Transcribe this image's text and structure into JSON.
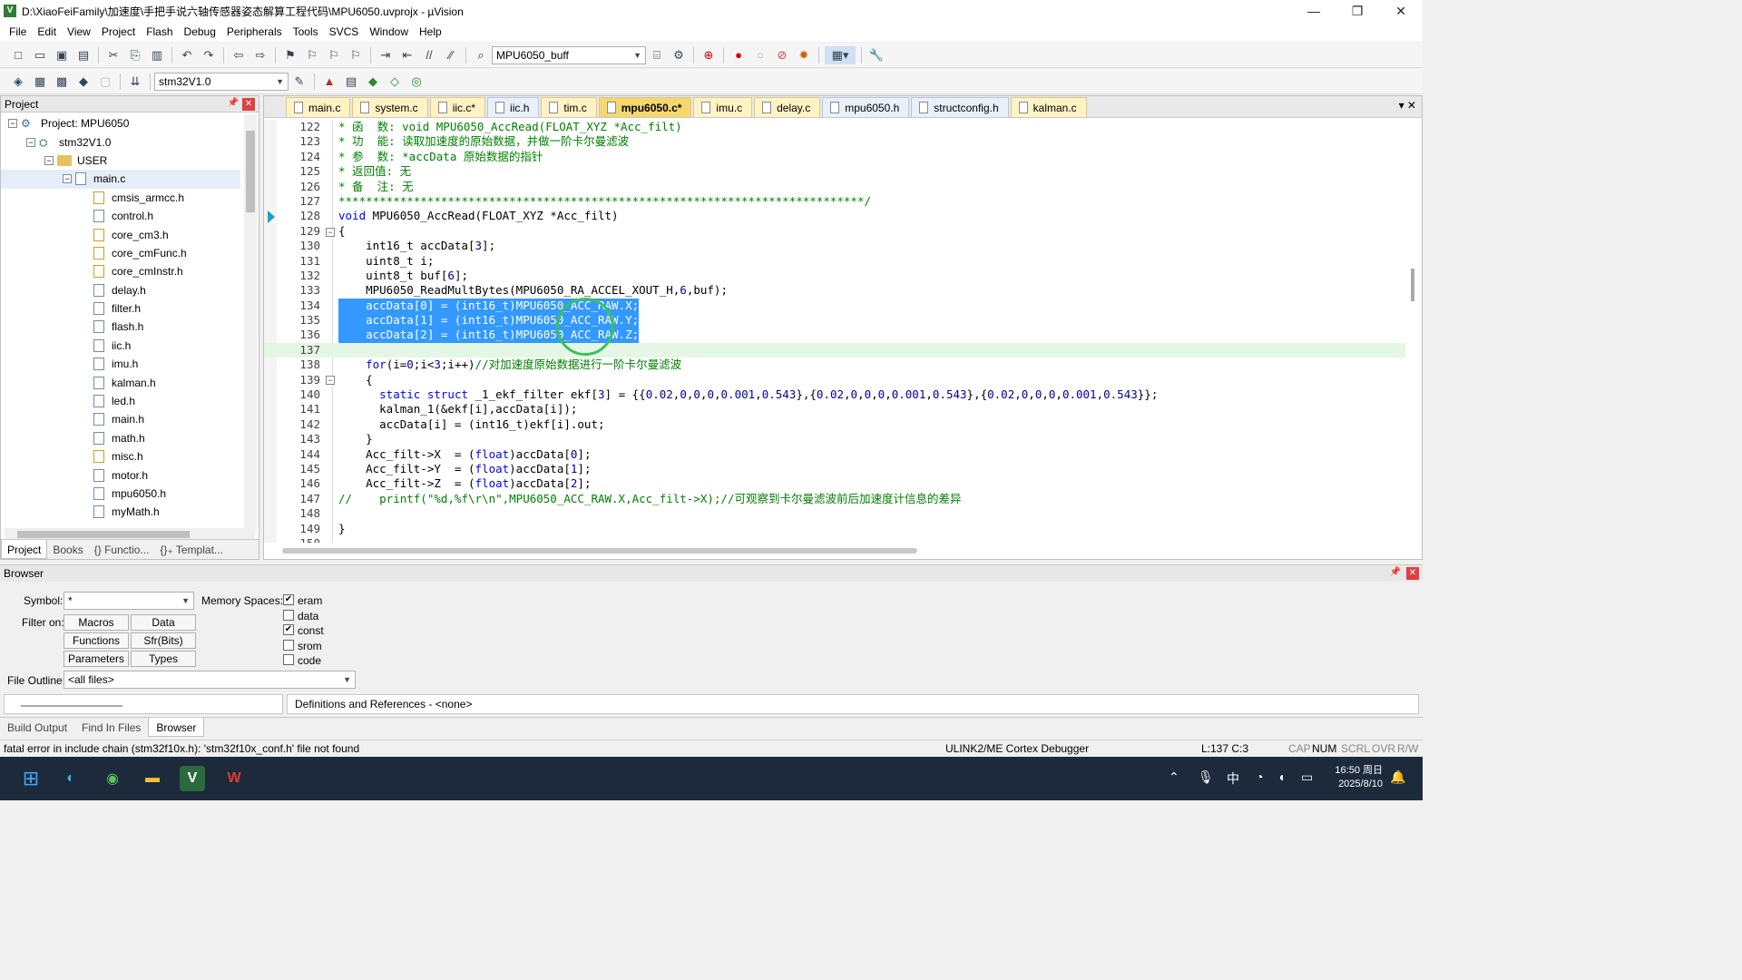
{
  "window": {
    "title": "D:\\XiaoFeiFamily\\加速度\\手把手说六轴传感器姿态解算工程代码\\MPU6050.uvprojx - µVision",
    "min": "—",
    "max": "❐",
    "close": "✕"
  },
  "menu": [
    "File",
    "Edit",
    "View",
    "Project",
    "Flash",
    "Debug",
    "Peripherals",
    "Tools",
    "SVCS",
    "Window",
    "Help"
  ],
  "toolbar": {
    "buffer_combo": "MPU6050_buff",
    "target_combo": "stm32V1.0"
  },
  "project_panel": {
    "title": "Project",
    "tree": [
      {
        "label": "Project: MPU6050",
        "level": 0,
        "type": "project",
        "exp": "−"
      },
      {
        "label": "stm32V1.0",
        "level": 1,
        "type": "target",
        "exp": "−"
      },
      {
        "label": "USER",
        "level": 2,
        "type": "folder",
        "exp": "−"
      },
      {
        "label": "main.c",
        "level": 3,
        "type": "file",
        "exp": "−",
        "selected": true
      },
      {
        "label": "cmsis_armcc.h",
        "level": 4,
        "type": "key"
      },
      {
        "label": "control.h",
        "level": 4,
        "type": "file"
      },
      {
        "label": "core_cm3.h",
        "level": 4,
        "type": "key"
      },
      {
        "label": "core_cmFunc.h",
        "level": 4,
        "type": "key"
      },
      {
        "label": "core_cmInstr.h",
        "level": 4,
        "type": "key"
      },
      {
        "label": "delay.h",
        "level": 4,
        "type": "file"
      },
      {
        "label": "filter.h",
        "level": 4,
        "type": "file"
      },
      {
        "label": "flash.h",
        "level": 4,
        "type": "file"
      },
      {
        "label": "iic.h",
        "level": 4,
        "type": "file"
      },
      {
        "label": "imu.h",
        "level": 4,
        "type": "file"
      },
      {
        "label": "kalman.h",
        "level": 4,
        "type": "file"
      },
      {
        "label": "led.h",
        "level": 4,
        "type": "file"
      },
      {
        "label": "main.h",
        "level": 4,
        "type": "file"
      },
      {
        "label": "math.h",
        "level": 4,
        "type": "file"
      },
      {
        "label": "misc.h",
        "level": 4,
        "type": "key"
      },
      {
        "label": "motor.h",
        "level": 4,
        "type": "file"
      },
      {
        "label": "mpu6050.h",
        "level": 4,
        "type": "file"
      },
      {
        "label": "myMath.h",
        "level": 4,
        "type": "file"
      }
    ],
    "tabs": [
      "Project",
      "Books",
      "{} Functio...",
      "{}₊ Templat..."
    ]
  },
  "editor": {
    "tabs": [
      {
        "label": "main.c",
        "kind": "c"
      },
      {
        "label": "system.c",
        "kind": "c"
      },
      {
        "label": "iic.c*",
        "kind": "c"
      },
      {
        "label": "iic.h",
        "kind": "h"
      },
      {
        "label": "tim.c",
        "kind": "c"
      },
      {
        "label": "mpu6050.c*",
        "kind": "c",
        "active": true
      },
      {
        "label": "imu.c",
        "kind": "c"
      },
      {
        "label": "delay.c",
        "kind": "c"
      },
      {
        "label": "mpu6050.h",
        "kind": "h"
      },
      {
        "label": "structconfig.h",
        "kind": "h"
      },
      {
        "label": "kalman.c",
        "kind": "c"
      }
    ],
    "lines": [
      {
        "n": "122",
        "t": "* 函  数: void MPU6050_AccRead(FLOAT_XYZ *Acc_filt)",
        "c": "cmt"
      },
      {
        "n": "123",
        "t": "* 功  能: 读取加速度的原始数据，并做一阶卡尔曼滤波",
        "c": "cmt"
      },
      {
        "n": "124",
        "t": "* 参  数: *accData 原始数据的指针",
        "c": "cmt"
      },
      {
        "n": "125",
        "t": "* 返回值: 无",
        "c": "cmt"
      },
      {
        "n": "126",
        "t": "* 备  注: 无",
        "c": "cmt"
      },
      {
        "n": "127",
        "t": "*****************************************************************************/",
        "c": "cmt"
      },
      {
        "n": "128",
        "t": "void MPU6050_AccRead(FLOAT_XYZ *Acc_filt)",
        "c": "code"
      },
      {
        "n": "129",
        "t": "{",
        "c": "code"
      },
      {
        "n": "130",
        "t": "    int16_t accData[3];",
        "c": "code"
      },
      {
        "n": "131",
        "t": "    uint8_t i;",
        "c": "code"
      },
      {
        "n": "132",
        "t": "    uint8_t buf[6];",
        "c": "code"
      },
      {
        "n": "133",
        "t": "    MPU6050_ReadMultBytes(MPU6050_RA_ACCEL_XOUT_H,6,buf);",
        "c": "code"
      },
      {
        "n": "134",
        "t": "    accData[0] = (int16_t)MPU6050_ACC_RAW.X;",
        "c": "hl"
      },
      {
        "n": "135",
        "t": "    accData[1] = (int16_t)MPU6050_ACC_RAW.Y;",
        "c": "hl"
      },
      {
        "n": "136",
        "t": "    accData[2] = (int16_t)MPU6050_ACC_RAW.Z;",
        "c": "hl"
      },
      {
        "n": "137",
        "t": "",
        "c": "cur"
      },
      {
        "n": "138",
        "t": "    for(i=0;i<3;i++)//对加速度原始数据进行一阶卡尔曼滤波",
        "c": "code"
      },
      {
        "n": "139",
        "t": "    {",
        "c": "code"
      },
      {
        "n": "140",
        "t": "      static struct _1_ekf_filter ekf[3] = {{0.02,0,0,0,0.001,0.543},{0.02,0,0,0,0.001,0.543},{0.02,0,0,0,0.001,0.543}};",
        "c": "code"
      },
      {
        "n": "141",
        "t": "      kalman_1(&ekf[i],accData[i]);",
        "c": "code"
      },
      {
        "n": "142",
        "t": "      accData[i] = (int16_t)ekf[i].out;",
        "c": "code"
      },
      {
        "n": "143",
        "t": "    }",
        "c": "code"
      },
      {
        "n": "144",
        "t": "    Acc_filt->X  = (float)accData[0];",
        "c": "code"
      },
      {
        "n": "145",
        "t": "    Acc_filt->Y  = (float)accData[1];",
        "c": "code"
      },
      {
        "n": "146",
        "t": "    Acc_filt->Z  = (float)accData[2];",
        "c": "code"
      },
      {
        "n": "147",
        "t": "//    printf(\"%d,%f\\r\\n\",MPU6050_ACC_RAW.X,Acc_filt->X);//可观察到卡尔曼滤波前后加速度计信息的差异",
        "c": "cmt"
      },
      {
        "n": "148",
        "t": "",
        "c": "code"
      },
      {
        "n": "149",
        "t": "}",
        "c": "code"
      },
      {
        "n": "150",
        "t": "",
        "c": "code"
      }
    ]
  },
  "browser": {
    "title": "Browser",
    "symbol_label": "Symbol:",
    "symbol_value": "*",
    "memory_label": "Memory Spaces:",
    "filter_label": "Filter on:",
    "buttons": [
      "Macros",
      "Data",
      "Functions",
      "Sfr(Bits)",
      "Parameters",
      "Types"
    ],
    "memory_spaces": [
      {
        "label": "eram",
        "checked": true
      },
      {
        "label": "data",
        "checked": false
      },
      {
        "label": "const",
        "checked": true
      },
      {
        "label": "srom",
        "checked": false
      },
      {
        "label": "code",
        "checked": false
      }
    ],
    "file_outline_label": "File Outline:",
    "file_outline_value": "<all files>",
    "definitions": "Definitions and References - <none>"
  },
  "output_tabs": [
    "Build Output",
    "Find In Files",
    "Browser"
  ],
  "status": {
    "message": "fatal error in include chain (stm32f10x.h): 'stm32f10x_conf.h' file not found",
    "debugger": "ULINK2/ME Cortex Debugger",
    "position": "L:137 C:3",
    "caps": "CAP",
    "num": "NUM",
    "scrl": "SCRL",
    "ovr": "OVR",
    "rw": "R/W"
  },
  "taskbar": {
    "time": "16:50 周日",
    "date": "2025/8/10",
    "ime": "中"
  }
}
